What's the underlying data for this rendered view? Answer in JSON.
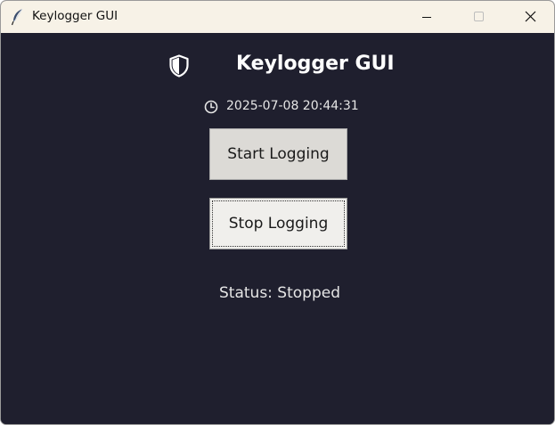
{
  "window": {
    "title": "Keylogger GUI",
    "app_icon": "feather-icon",
    "controls": [
      "minimize-icon",
      "maximize-icon",
      "close-icon"
    ]
  },
  "main": {
    "heading_icon": "shield-icon",
    "heading": "Keylogger GUI",
    "clock_icon": "clock-icon",
    "timestamp": "2025-07-08 20:44:31",
    "start_button_label": "Start Logging",
    "stop_button_label": "Stop Logging",
    "status_text": "Status: Stopped"
  },
  "colors": {
    "titlebar": "#f7f2e7",
    "background": "#1f1f2e",
    "text": "#ffffff",
    "button_start": "#dcdad6",
    "button_stop": "#f0efec"
  }
}
